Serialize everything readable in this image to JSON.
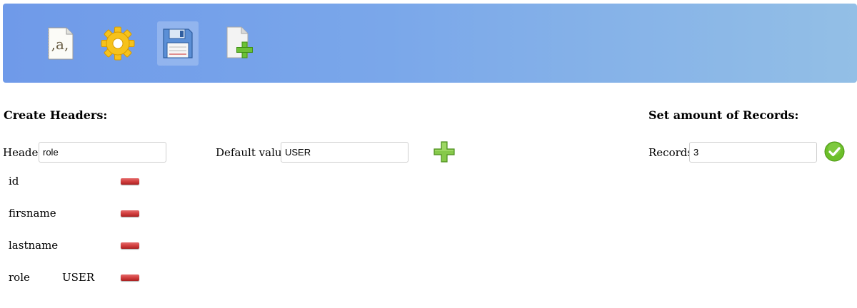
{
  "toolbar": {
    "buttons": [
      {
        "icon": "text-delimiter-icon"
      },
      {
        "icon": "gear-icon"
      },
      {
        "icon": "floppy-save-icon",
        "active": true
      },
      {
        "icon": "new-document-icon"
      }
    ]
  },
  "headers_section": {
    "title": "Create Headers:",
    "header_label": "Header",
    "header_value": "role",
    "default_label": "Default value",
    "default_value": "USER",
    "add_icon": "plus-icon",
    "rows": [
      {
        "name": "id",
        "default": ""
      },
      {
        "name": "firsname",
        "default": ""
      },
      {
        "name": "lastname",
        "default": ""
      },
      {
        "name": "role",
        "default": "USER"
      }
    ],
    "remove_icon": "minus-icon"
  },
  "records_section": {
    "title": "Set amount of Records:",
    "records_label": "Records",
    "records_value": "3",
    "confirm_icon": "checkmark-icon"
  },
  "colors": {
    "toolbar_gradient_start": "#6f9ae9",
    "toolbar_gradient_end": "#93bfe6",
    "add_green": "#7cc13a",
    "remove_red": "#cf3b3b",
    "confirm_green": "#6cbf2a"
  }
}
